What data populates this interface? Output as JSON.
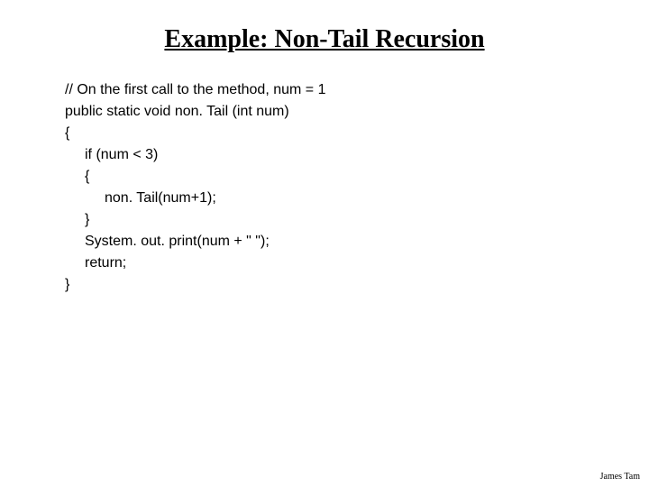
{
  "title": "Example: Non-Tail Recursion",
  "code": {
    "l1": "// On the first call to the method, num = 1",
    "l2": "public static void non. Tail (int num)",
    "l3": "{",
    "l4": "if (num < 3)",
    "l5": "{",
    "l6": "non. Tail(num+1);",
    "l7": "}",
    "l8": "System. out. print(num + \" \");",
    "l9": "return;",
    "l10": "}"
  },
  "footer": "James Tam"
}
